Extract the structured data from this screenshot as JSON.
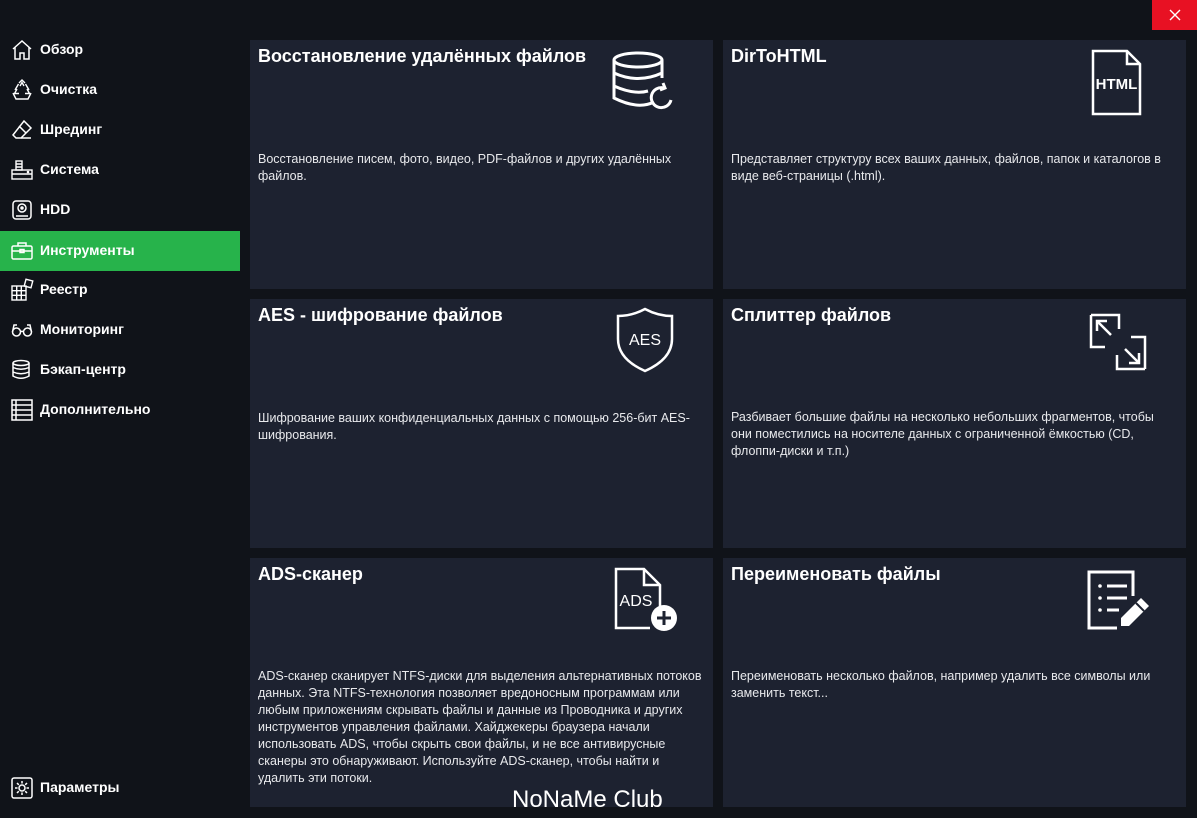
{
  "sidebar": {
    "items": [
      {
        "label": "Обзор",
        "icon": "home-icon"
      },
      {
        "label": "Очистка",
        "icon": "recycle-icon"
      },
      {
        "label": "Шрединг",
        "icon": "eraser-icon"
      },
      {
        "label": "Система",
        "icon": "system-icon"
      },
      {
        "label": "HDD",
        "icon": "hdd-icon"
      },
      {
        "label": "Инструменты",
        "icon": "toolbox-icon",
        "active": true
      },
      {
        "label": "Реестр",
        "icon": "registry-icon"
      },
      {
        "label": "Мониторинг",
        "icon": "glasses-icon"
      },
      {
        "label": "Бэкап-центр",
        "icon": "database-icon"
      },
      {
        "label": "Дополнительно",
        "icon": "list-icon"
      }
    ],
    "settings_label": "Параметры"
  },
  "tools": {
    "recover": {
      "title": "Восстановление удалённых файлов",
      "description": "Восстановление писем, фото, видео, PDF-файлов и других удалённых файлов."
    },
    "dirtohtml": {
      "title": "DirToHTML",
      "icon_text": "HTML",
      "description": "Представляет структуру всех ваших данных, файлов, папок и каталогов в виде веб-страницы (.html)."
    },
    "aes": {
      "title": "AES - шифрование файлов",
      "icon_text": "AES",
      "description": "Шифрование ваших конфиденциальных данных с помощью 256-бит AES-шифрования."
    },
    "splitter": {
      "title": "Сплиттер файлов",
      "description": "Разбивает большие файлы на несколько небольших фрагментов, чтобы они поместились на носителе данных с ограниченной ёмкостью (CD, флоппи-диски и т.п.)"
    },
    "ads": {
      "title": "ADS-сканер",
      "icon_text": "ADS",
      "description": "ADS-сканер сканирует NTFS-диски для выделения альтернативных потоков данных. Эта NTFS-технология позволяет вредоносным программам или любым приложениям скрывать файлы и данные из Проводника и других инструментов управления файлами. Хайджекеры браузера начали использовать ADS, чтобы скрыть свои файлы, и не все антивирусные сканеры это обнаруживают. Используйте ADS-сканер, чтобы найти и удалить эти потоки."
    },
    "rename": {
      "title": "Переименовать файлы",
      "description": "Переименовать несколько файлов, например удалить все символы или заменить текст..."
    }
  },
  "watermark": "NoNaMe Club",
  "colors": {
    "active": "#27b34b",
    "card": "#1d2230",
    "background": "#101319",
    "close": "#e81123"
  }
}
